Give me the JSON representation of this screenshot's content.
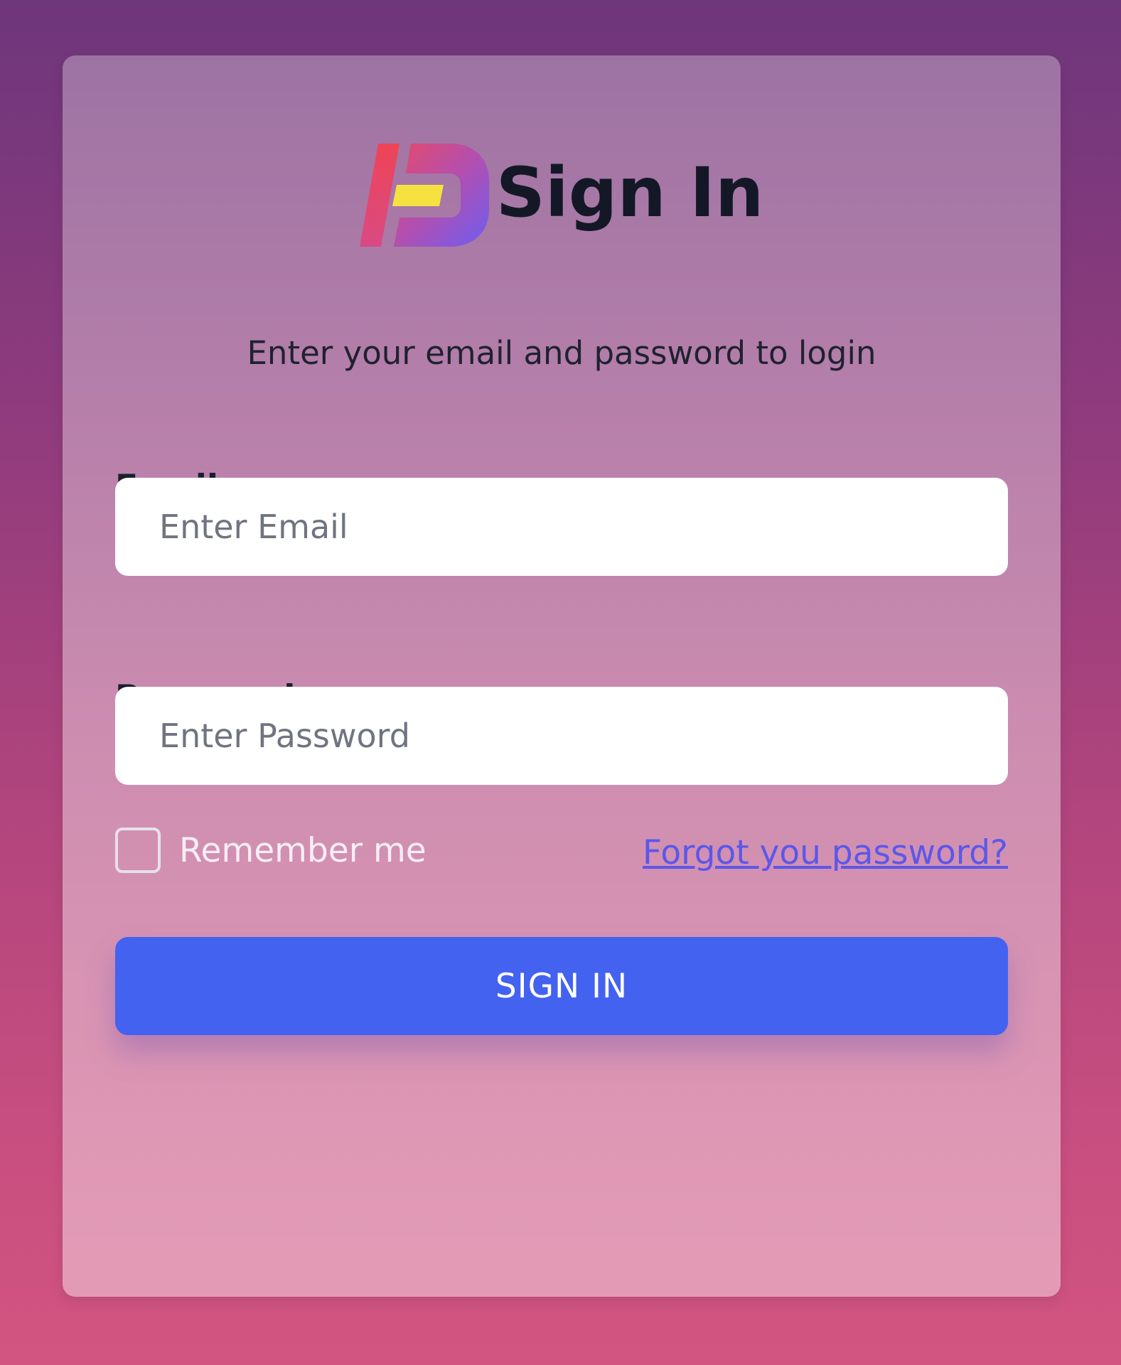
{
  "header": {
    "title": "Sign In",
    "logo_icon": "brand-logo-icon"
  },
  "subtitle": "Enter your email and password to login",
  "form": {
    "email_label": "Email",
    "email_placeholder": "Enter Email",
    "email_value": "",
    "password_label": "Password",
    "password_placeholder": "Enter Password",
    "password_value": "",
    "remember_label": "Remember me",
    "remember_checked": false,
    "forgot_link": "Forgot you password?",
    "submit_label": "SIGN IN"
  },
  "colors": {
    "primary_button": "#4462f0",
    "link": "#5b57ea",
    "background_top": "#6e367b",
    "background_bottom": "#d25480",
    "logo_red": "#ec4559",
    "logo_purple": "#6d5df2",
    "logo_yellow": "#f5e140"
  }
}
